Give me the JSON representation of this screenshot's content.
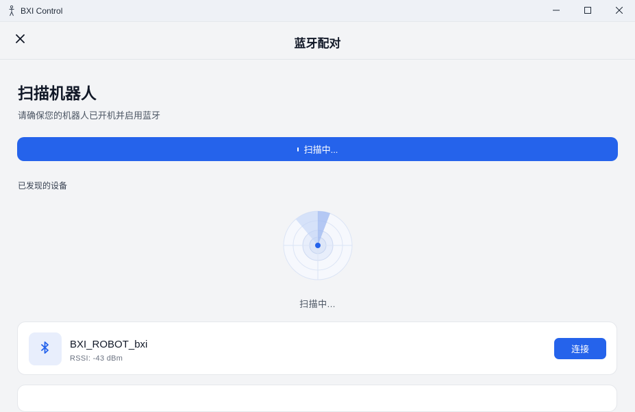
{
  "window": {
    "title": "BXI Control",
    "icon": "robot-figure-icon",
    "controls": [
      "minimize-icon",
      "maximize-icon",
      "close-icon"
    ]
  },
  "header": {
    "title": "蓝牙配对",
    "close_icon": "close-icon"
  },
  "main": {
    "title": "扫描机器人",
    "subtitle": "请确保您的机器人已开机并启用蓝牙",
    "scan_button_label": "扫描中...",
    "section_label": "已发现的设备",
    "scan_status": "扫描中..."
  },
  "devices": [
    {
      "name": "BXI_ROBOT_bxi",
      "rssi": "RSSI: -43 dBm",
      "icon": "bluetooth-icon",
      "action_label": "连接"
    }
  ],
  "colors": {
    "accent": "#2563eb",
    "background": "#f3f4f6",
    "card": "#ffffff",
    "icon_box": "#e8eefc"
  }
}
